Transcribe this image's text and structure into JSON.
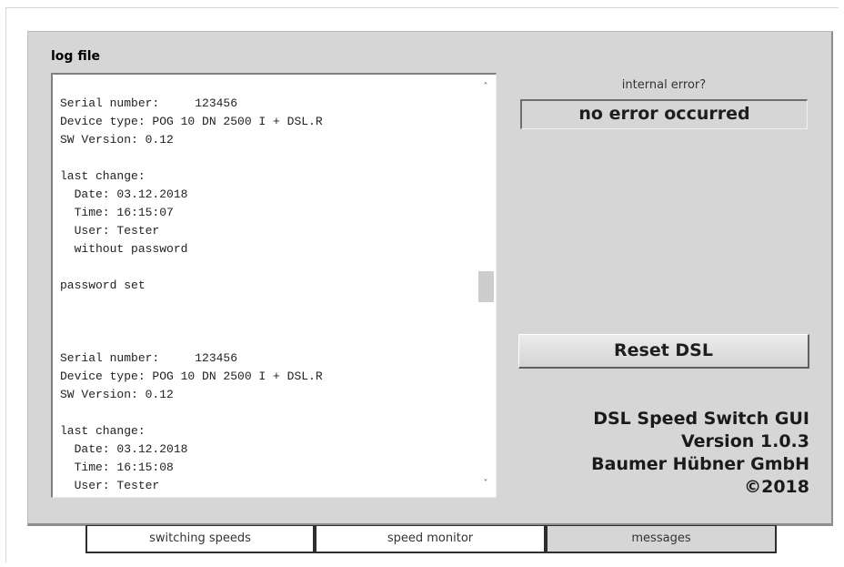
{
  "log": {
    "title": "log file",
    "content": "Serial number:     123456\nDevice type: POG 10 DN 2500 I + DSL.R\nSW Version: 0.12\n\nlast change:\n  Date: 03.12.2018\n  Time: 16:15:07\n  User: Tester\n  without password\n\npassword set\n\n\n\nSerial number:     123456\nDevice type: POG 10 DN 2500 I + DSL.R\nSW Version: 0.12\n\nlast change:\n  Date: 03.12.2018\n  Time: 16:15:08\n  User: Tester",
    "scroll_up_icon": "chevron-up-icon",
    "scroll_down_icon": "chevron-down-icon"
  },
  "status": {
    "label": "internal error?",
    "value": "no error occurred"
  },
  "actions": {
    "reset_label": "Reset DSL"
  },
  "about": {
    "app_name": "DSL Speed Switch GUI",
    "version": "Version 1.0.3",
    "company": "Baumer Hübner GmbH",
    "copyright": "©2018"
  },
  "tabs": [
    {
      "label": "switching speeds",
      "active": false
    },
    {
      "label": "speed monitor",
      "active": false
    },
    {
      "label": "messages",
      "active": true
    }
  ]
}
